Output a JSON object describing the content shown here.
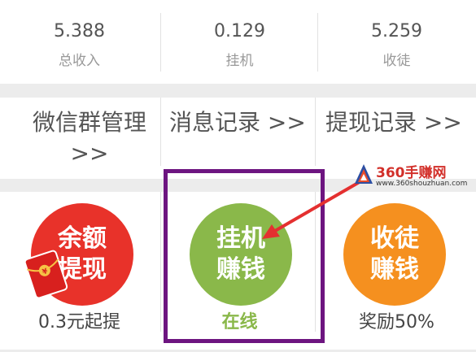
{
  "stats": [
    {
      "value": "5.388",
      "label": "总收入"
    },
    {
      "value": "0.129",
      "label": "挂机"
    },
    {
      "value": "5.259",
      "label": "收徒"
    }
  ],
  "links": [
    {
      "line1": "微信群管理",
      "line2": ">>"
    },
    {
      "line1": "消息记录 >>"
    },
    {
      "line1": "提现记录 >>"
    }
  ],
  "actions": [
    {
      "line1": "余额",
      "line2": "提现",
      "caption": "0.3元起提"
    },
    {
      "line1": "挂机",
      "line2": "赚钱",
      "caption": "在线"
    },
    {
      "line1": "收徒",
      "line2": "赚钱",
      "caption": "奖励50%"
    }
  ],
  "watermark": {
    "title": "360手赚网",
    "url": "www.360shouzhuan.com"
  },
  "colors": {
    "highlight_border": "#6d1580",
    "arrow": "#e43030",
    "withdraw_circle": "#e8322a",
    "idle_circle": "#8ab84a",
    "recruit_circle": "#f5901f"
  }
}
